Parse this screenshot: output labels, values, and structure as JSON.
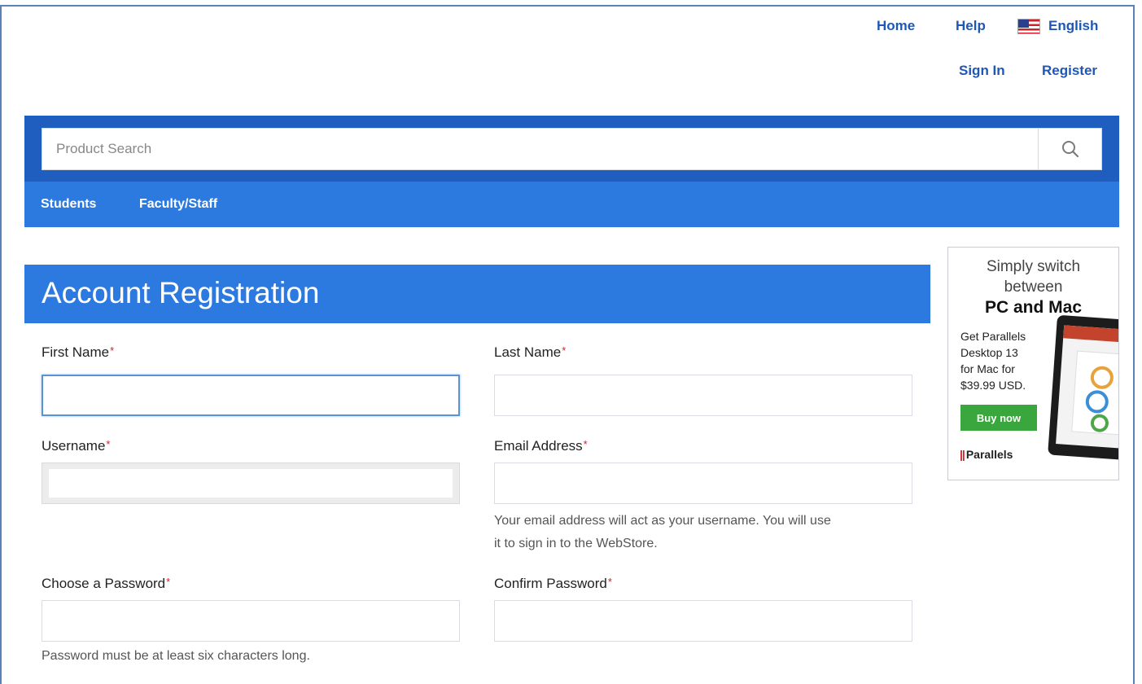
{
  "top_nav": {
    "home": "Home",
    "help": "Help",
    "language": "English",
    "sign_in": "Sign In",
    "register": "Register"
  },
  "search": {
    "placeholder": "Product Search",
    "value": ""
  },
  "nav": {
    "items": [
      {
        "label": "Students"
      },
      {
        "label": "Faculty/Staff"
      }
    ]
  },
  "registration": {
    "title": "Account Registration",
    "required_marker": "*",
    "first_name": {
      "label": "First Name",
      "value": ""
    },
    "last_name": {
      "label": "Last Name",
      "value": ""
    },
    "username": {
      "label": "Username",
      "value": ""
    },
    "email": {
      "label": "Email Address",
      "value": "",
      "help_line1": "Your email address will act as your username. You will use",
      "help_line2": "it to sign in to the WebStore."
    },
    "password": {
      "label": "Choose a Password",
      "value": "",
      "help": "Password must be at least six characters long."
    },
    "confirm_password": {
      "label": "Confirm Password",
      "value": ""
    }
  },
  "ad": {
    "headline_line1": "Simply switch",
    "headline_line2": "between",
    "headline_bold": "PC and Mac",
    "copy_lines": [
      "Get Parallels",
      "Desktop 13",
      "for Mac for",
      "$39.99 USD."
    ],
    "button": "Buy now",
    "brand_bars": "||",
    "brand": "Parallels",
    "brand_tm": "·"
  },
  "colors": {
    "link": "#1f57b5",
    "search_band": "#1f5dbf",
    "nav_band": "#2c7ae0",
    "required": "#d12026",
    "ad_button": "#3aa63e"
  }
}
